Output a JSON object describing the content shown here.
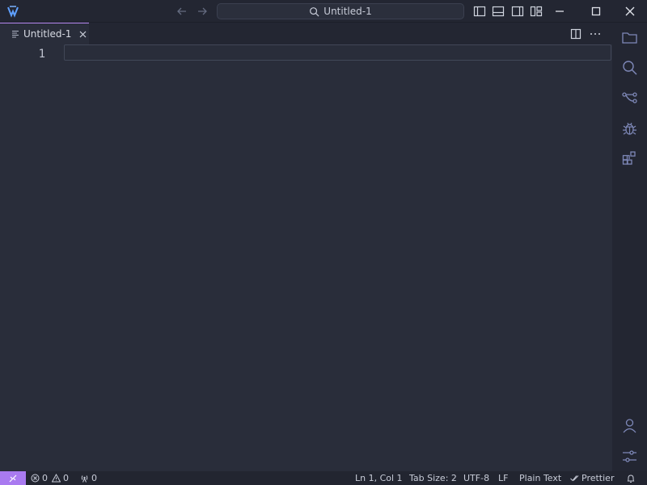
{
  "window": {
    "title": "Untitled-1"
  },
  "tabs": [
    {
      "label": "Untitled-1",
      "active": true
    }
  ],
  "editor": {
    "line_numbers": [
      "1"
    ]
  },
  "statusbar": {
    "errors": "0",
    "warnings": "0",
    "ports": "0",
    "cursor": "Ln 1, Col 1",
    "tab_size": "Tab Size: 2",
    "encoding": "UTF-8",
    "eol": "LF",
    "language": "Plain Text",
    "formatter": "Prettier"
  },
  "activity_icons": [
    "explorer-icon",
    "search-icon",
    "source-control-icon",
    "debug-icon",
    "extensions-icon",
    "account-icon",
    "settings-icon"
  ],
  "colors": {
    "accent": "#a97af0",
    "background": "#292d3a",
    "chrome": "#232632",
    "icon": "#7e88b8"
  }
}
